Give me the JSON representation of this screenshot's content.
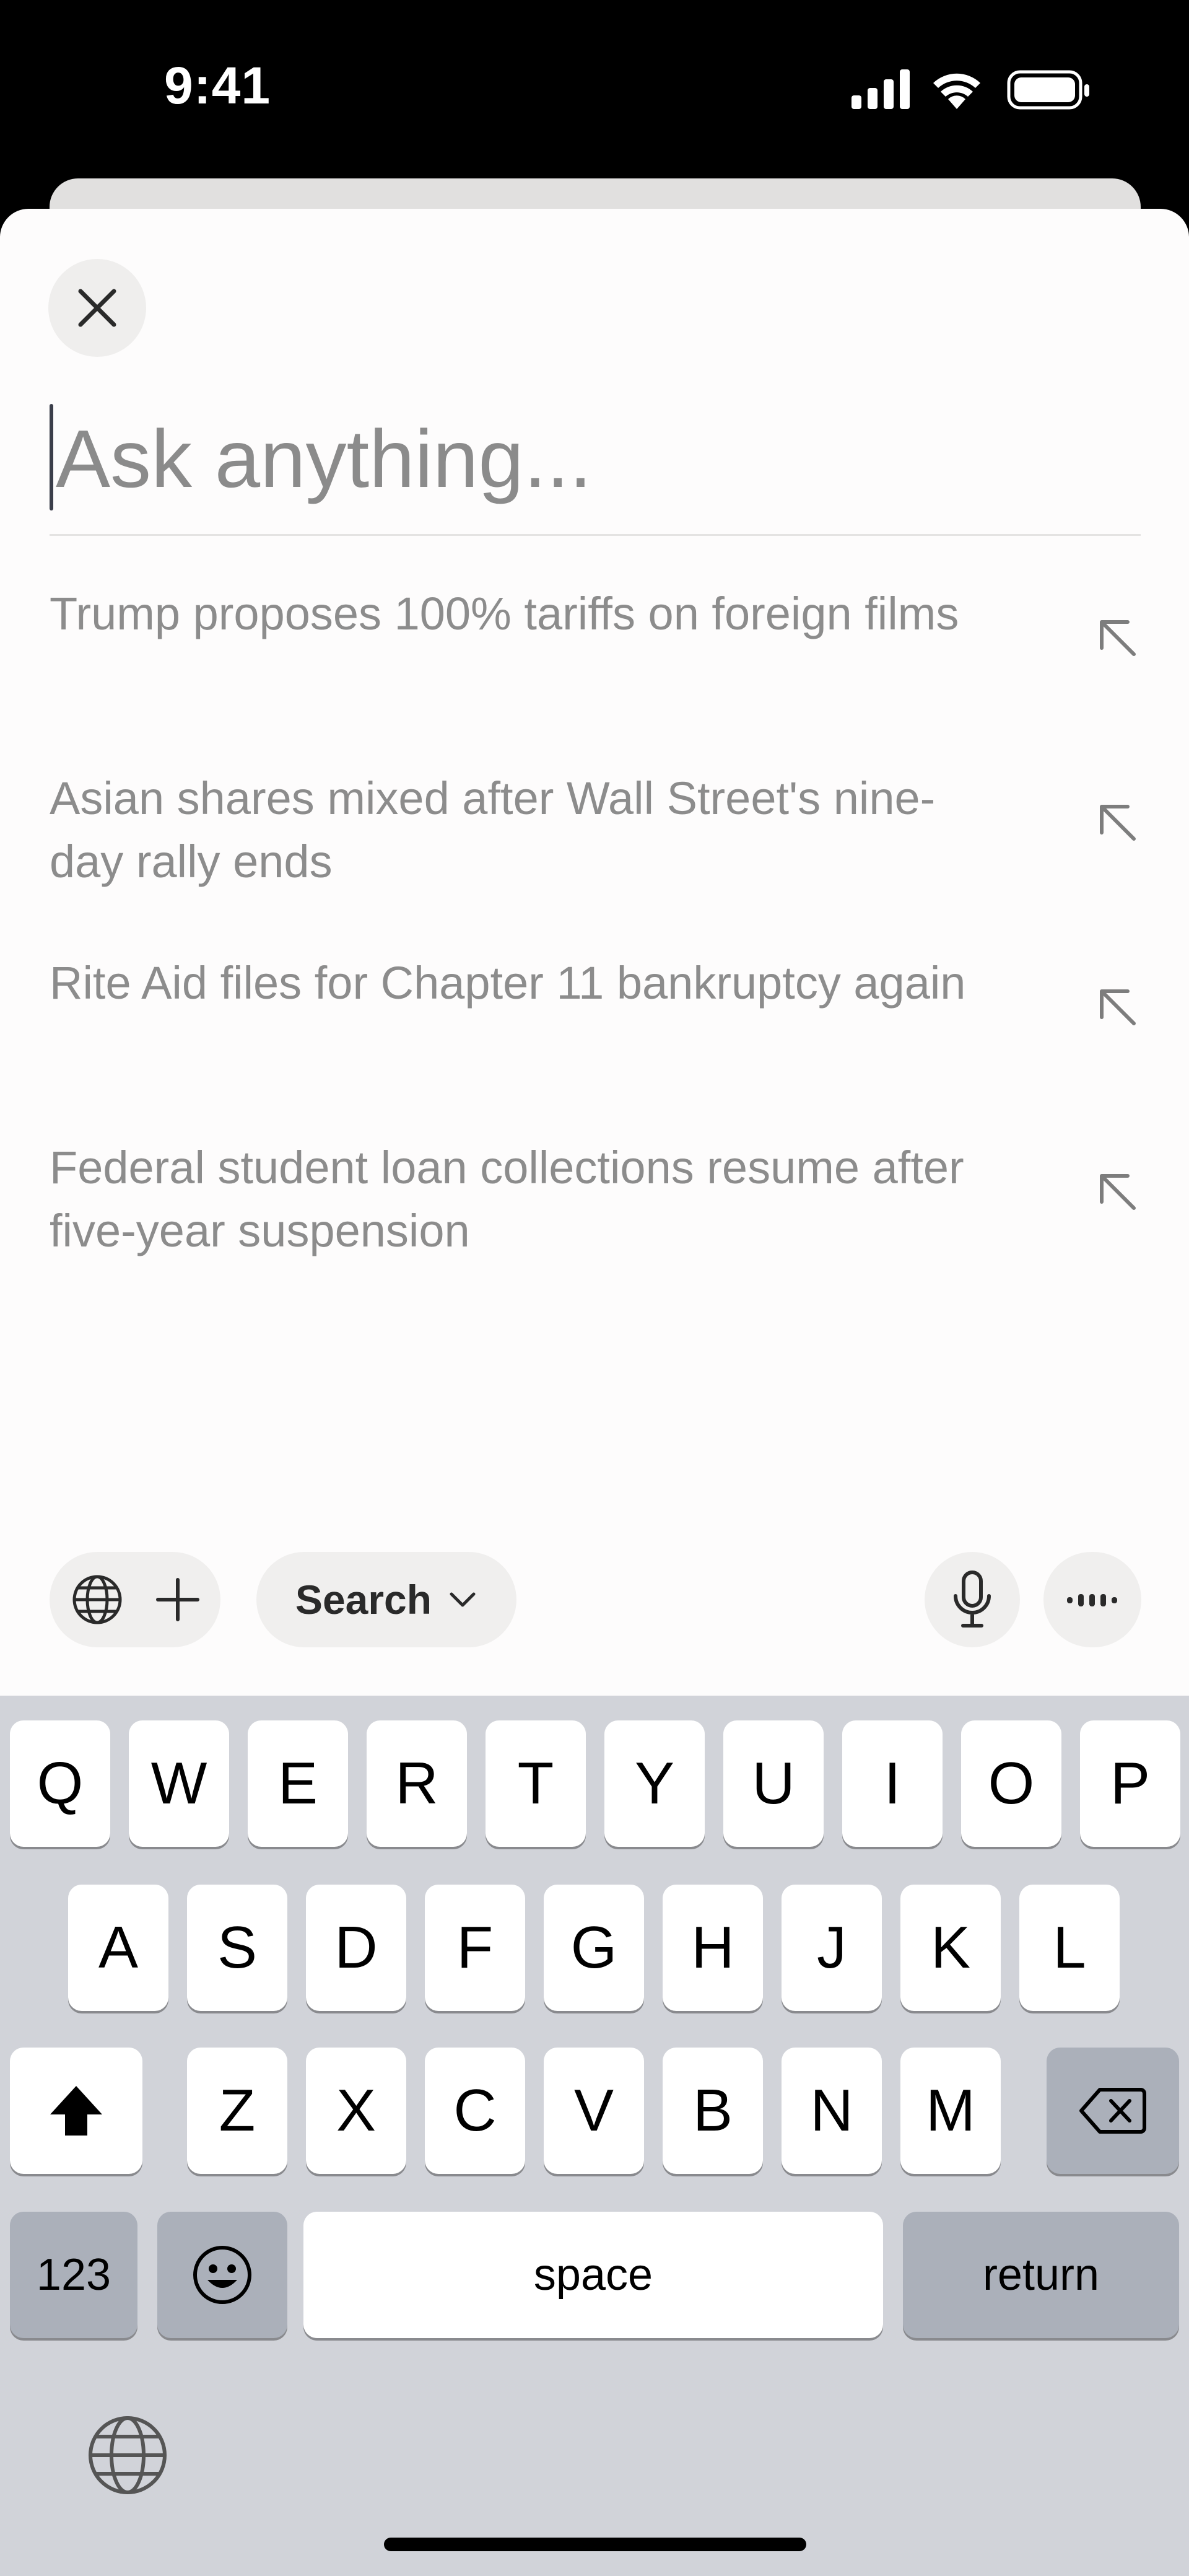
{
  "status_bar": {
    "time": "9:41",
    "icons": [
      "signal-icon",
      "wifi-icon",
      "battery-icon"
    ]
  },
  "sheet": {
    "close_icon": "close-icon"
  },
  "input": {
    "value": "",
    "placeholder": "Ask anything..."
  },
  "suggestions": [
    {
      "text": "Trump proposes 100% tariffs on foreign films",
      "icon": "arrow-up-left-icon"
    },
    {
      "text": "Asian shares mixed after Wall Street's nine-day rally ends",
      "icon": "arrow-up-left-icon"
    },
    {
      "text": "Rite Aid files for Chapter 11 bankruptcy again",
      "icon": "arrow-up-left-icon"
    },
    {
      "text": "Federal student loan collections resume after five-year suspension",
      "icon": "arrow-up-left-icon"
    }
  ],
  "toolbar": {
    "globe_icon": "globe-icon",
    "add_icon": "plus-icon",
    "mode_label": "Search",
    "mode_icon": "chevron-down-icon",
    "mic_icon": "microphone-icon",
    "voice_icon": "voice-mode-icon"
  },
  "keyboard": {
    "row1": [
      "Q",
      "W",
      "E",
      "R",
      "T",
      "Y",
      "U",
      "I",
      "O",
      "P"
    ],
    "row2": [
      "A",
      "S",
      "D",
      "F",
      "G",
      "H",
      "J",
      "K",
      "L"
    ],
    "row3": [
      "Z",
      "X",
      "C",
      "V",
      "B",
      "N",
      "M"
    ],
    "numbers_label": "123",
    "space_label": "space",
    "return_label": "return",
    "shift_icon": "shift-icon",
    "delete_icon": "delete-icon",
    "emoji_icon": "emoji-icon",
    "globe_icon": "globe-icon"
  },
  "colors": {
    "sheet_bg": "#fdfcfc",
    "keyboard_bg": "#d1d3d9",
    "placeholder": "#8b8b8b",
    "suggestion_text": "#8c8c8c"
  }
}
